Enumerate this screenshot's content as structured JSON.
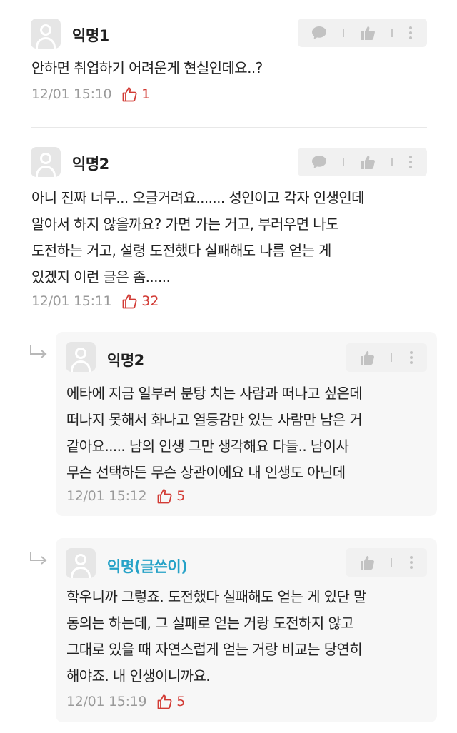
{
  "colors": {
    "accent_op": "#26a2c7",
    "like_red": "#d23b35",
    "meta_gray": "#9a9a9a",
    "reply_bg": "#f7f7f7"
  },
  "icons": {
    "comment": "speech-bubble-icon",
    "like": "thumbs-up-icon",
    "more": "more-vertical-icon",
    "reply": "reply-arrow-icon",
    "avatar": "user-avatar-icon"
  },
  "comments": [
    {
      "author": "익명1",
      "lines": [
        "안하면 취업하기 어려운게 현실인데요..?"
      ],
      "time": "12/01 15:10",
      "likes": "1"
    },
    {
      "author": "익명2",
      "lines": [
        "아니 진짜 너무... 오글거려요....... 성인이고 각자 인생인데",
        "알아서 하지 않을까요? 가면 가는 거고, 부러우면 나도",
        "도전하는 거고, 설령 도전했다 실패해도 나름 얻는 게",
        "있겠지 이런 글은 좀......"
      ],
      "time": "12/01 15:11",
      "likes": "32"
    }
  ],
  "replies": [
    {
      "author": "익명2",
      "lines": [
        "에타에 지금 일부러 분탕 치는 사람과 떠나고 싶은데",
        "떠나지 못해서 화나고 열등감만 있는 사람만 남은 거",
        "같아요..... 남의 인생 그만 생각해요 다들.. 남이사",
        "무슨 선택하든 무슨 상관이에요 내 인생도 아닌데"
      ],
      "time": "12/01 15:12",
      "likes": "5"
    },
    {
      "author": "익명(글쓴이)",
      "lines": [
        "학우니까 그렇죠. 도전했다 실패해도 얻는 게 있단 말",
        "동의는 하는데, 그 실패로 얻는 거랑 도전하지 않고",
        "그대로 있을 때 자연스럽게 얻는 거랑 비교는 당연히",
        "해야죠. 내 인생이니까요."
      ],
      "time": "12/01 15:19",
      "likes": "5"
    }
  ]
}
